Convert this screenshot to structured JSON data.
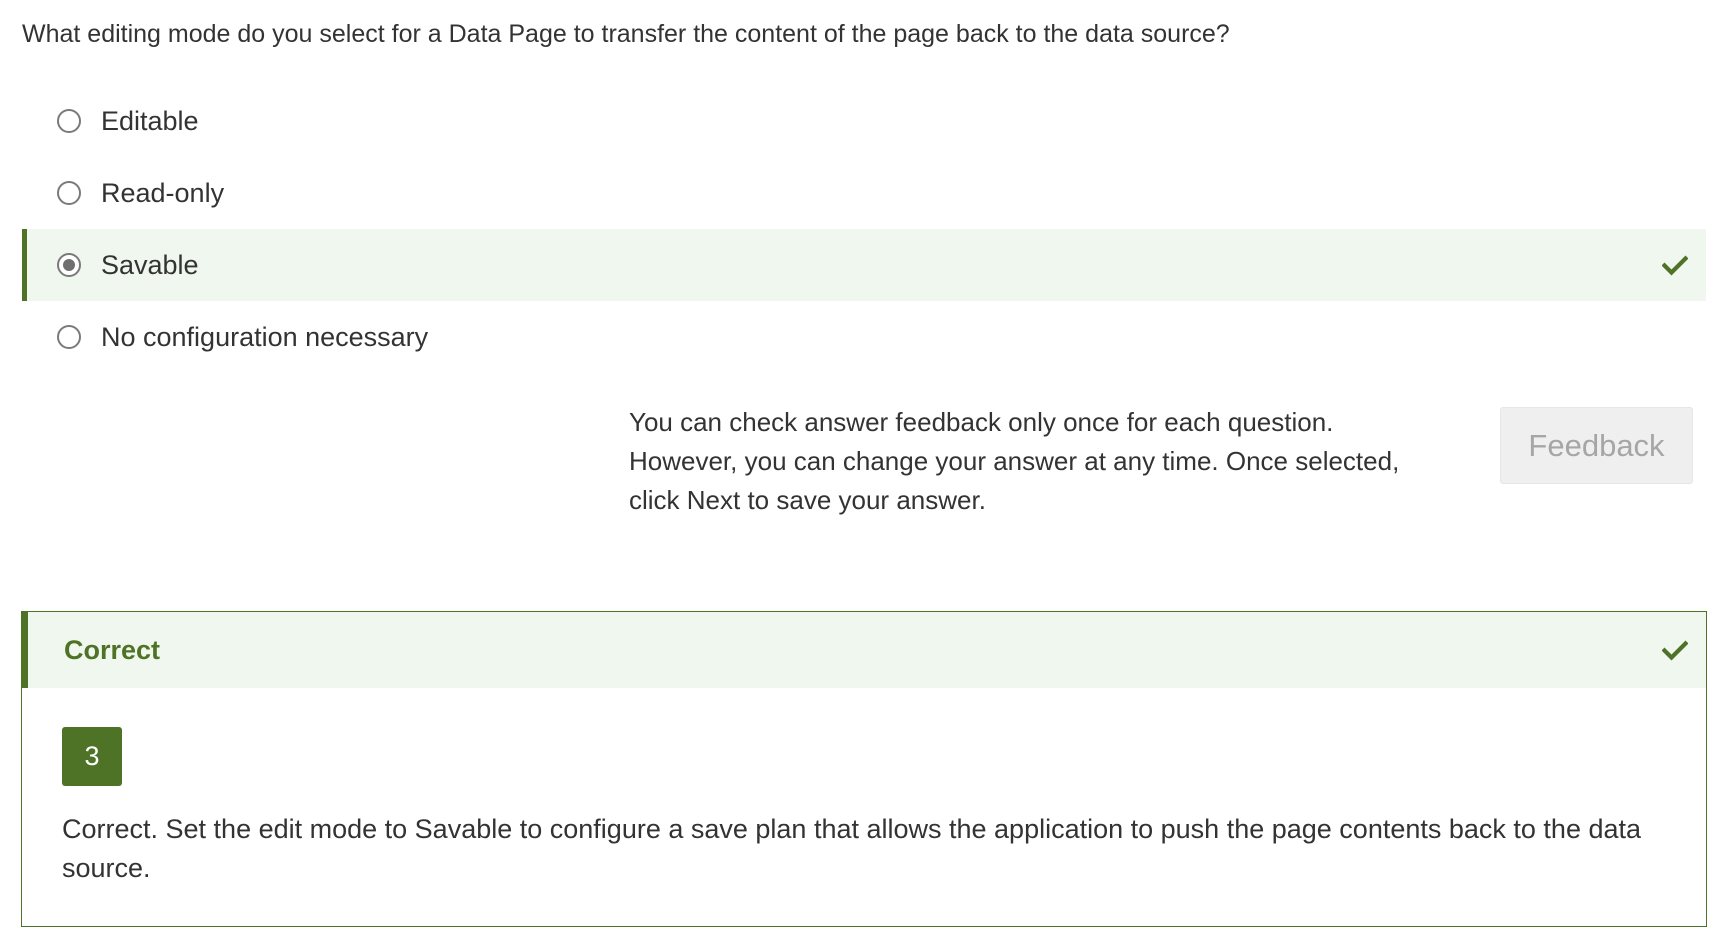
{
  "question": {
    "text": "What editing mode do you select for a Data Page to transfer the content of the page back to the data source?"
  },
  "options": [
    {
      "label": "Editable",
      "selected": false
    },
    {
      "label": "Read-only",
      "selected": false
    },
    {
      "label": "Savable",
      "selected": true,
      "correct": true
    },
    {
      "label": "No configuration necessary",
      "selected": false
    }
  ],
  "info": {
    "lines": [
      "You can check answer feedback only once for each question.",
      "However, you can change your answer at any time. Once selected,",
      "click Next to save your answer."
    ]
  },
  "feedback_button": {
    "label": "Feedback",
    "enabled": false
  },
  "result": {
    "title": "Correct",
    "answer_number": "3",
    "explanation": "Correct. Set the edit mode to Savable to configure a save plan that allows the application to push the page contents back to the data source."
  },
  "icons": {
    "correct": "check-icon"
  },
  "colors": {
    "accent_green": "#4f7326",
    "selected_background": "#f0f7ee",
    "button_background": "#efefef",
    "button_text_disabled": "#a6a6a6",
    "text": "#333333"
  }
}
